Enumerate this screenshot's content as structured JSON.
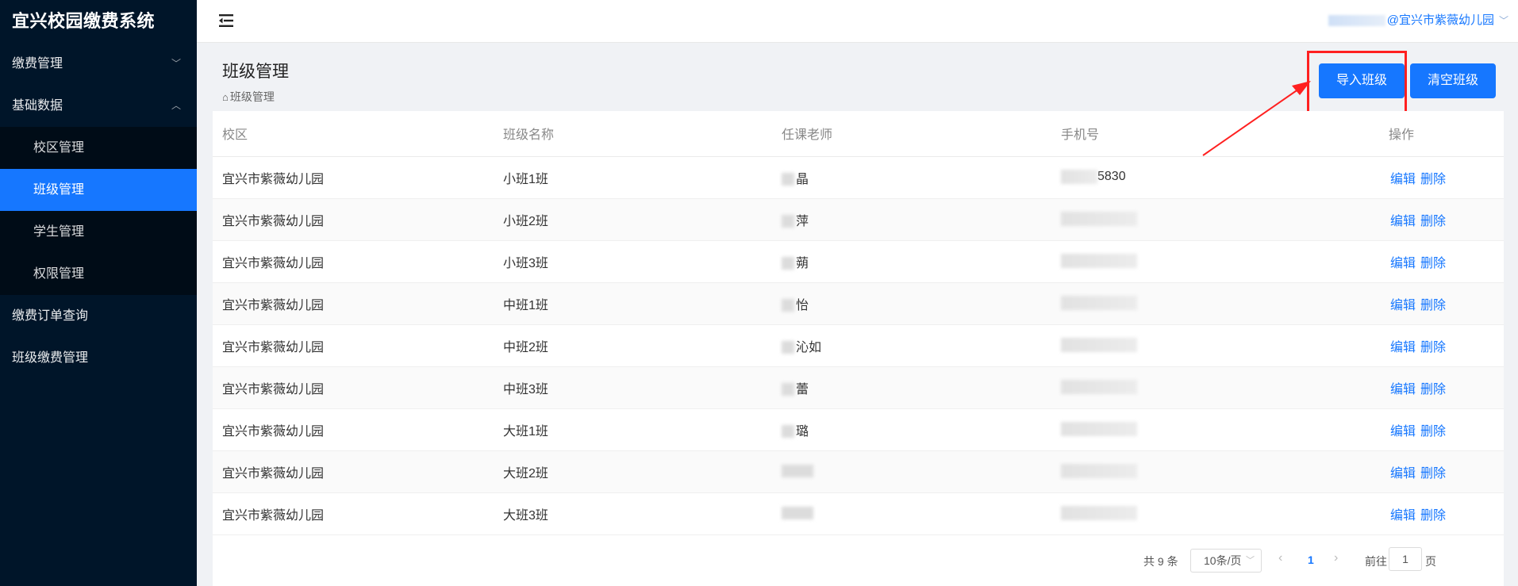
{
  "app": {
    "title": "宜兴校园缴费系统"
  },
  "sidebar": {
    "items": [
      {
        "label": "缴费管理",
        "chevron": "﹀"
      },
      {
        "label": "基础数据",
        "chevron": "︿"
      },
      {
        "label": "校区管理"
      },
      {
        "label": "班级管理"
      },
      {
        "label": "学生管理"
      },
      {
        "label": "权限管理"
      },
      {
        "label": "缴费订单查询"
      },
      {
        "label": "班级缴费管理"
      }
    ]
  },
  "header": {
    "user": "@宜兴市紫薇幼儿园"
  },
  "page": {
    "title": "班级管理",
    "breadcrumb": "班级管理",
    "import_label": "导入班级",
    "clear_label": "清空班级"
  },
  "table": {
    "headers": [
      "校区",
      "班级名称",
      "任课老师",
      "手机号",
      "操作"
    ],
    "rows": [
      {
        "campus": "宜兴市紫薇幼儿园",
        "class": "小班1班",
        "teacher": "晶",
        "phone": "5830"
      },
      {
        "campus": "宜兴市紫薇幼儿园",
        "class": "小班2班",
        "teacher": "萍",
        "phone": ""
      },
      {
        "campus": "宜兴市紫薇幼儿园",
        "class": "小班3班",
        "teacher": "蒴",
        "phone": ""
      },
      {
        "campus": "宜兴市紫薇幼儿园",
        "class": "中班1班",
        "teacher": "怡",
        "phone": ""
      },
      {
        "campus": "宜兴市紫薇幼儿园",
        "class": "中班2班",
        "teacher": "沁如",
        "phone": ""
      },
      {
        "campus": "宜兴市紫薇幼儿园",
        "class": "中班3班",
        "teacher": "蕾",
        "phone": ""
      },
      {
        "campus": "宜兴市紫薇幼儿园",
        "class": "大班1班",
        "teacher": "璐",
        "phone": ""
      },
      {
        "campus": "宜兴市紫薇幼儿园",
        "class": "大班2班",
        "teacher": "",
        "phone": ""
      },
      {
        "campus": "宜兴市紫薇幼儿园",
        "class": "大班3班",
        "teacher": "",
        "phone": ""
      }
    ],
    "edit_label": "编辑",
    "delete_label": "删除"
  },
  "pagination": {
    "total": "共 9 条",
    "page_size": "10条/页",
    "current": "1",
    "goto_prefix": "前往",
    "goto_value": "1",
    "goto_suffix": "页"
  },
  "colors": {
    "primary": "#1677ff",
    "sidebar_bg": "#001529",
    "highlight": "#ff2020"
  }
}
